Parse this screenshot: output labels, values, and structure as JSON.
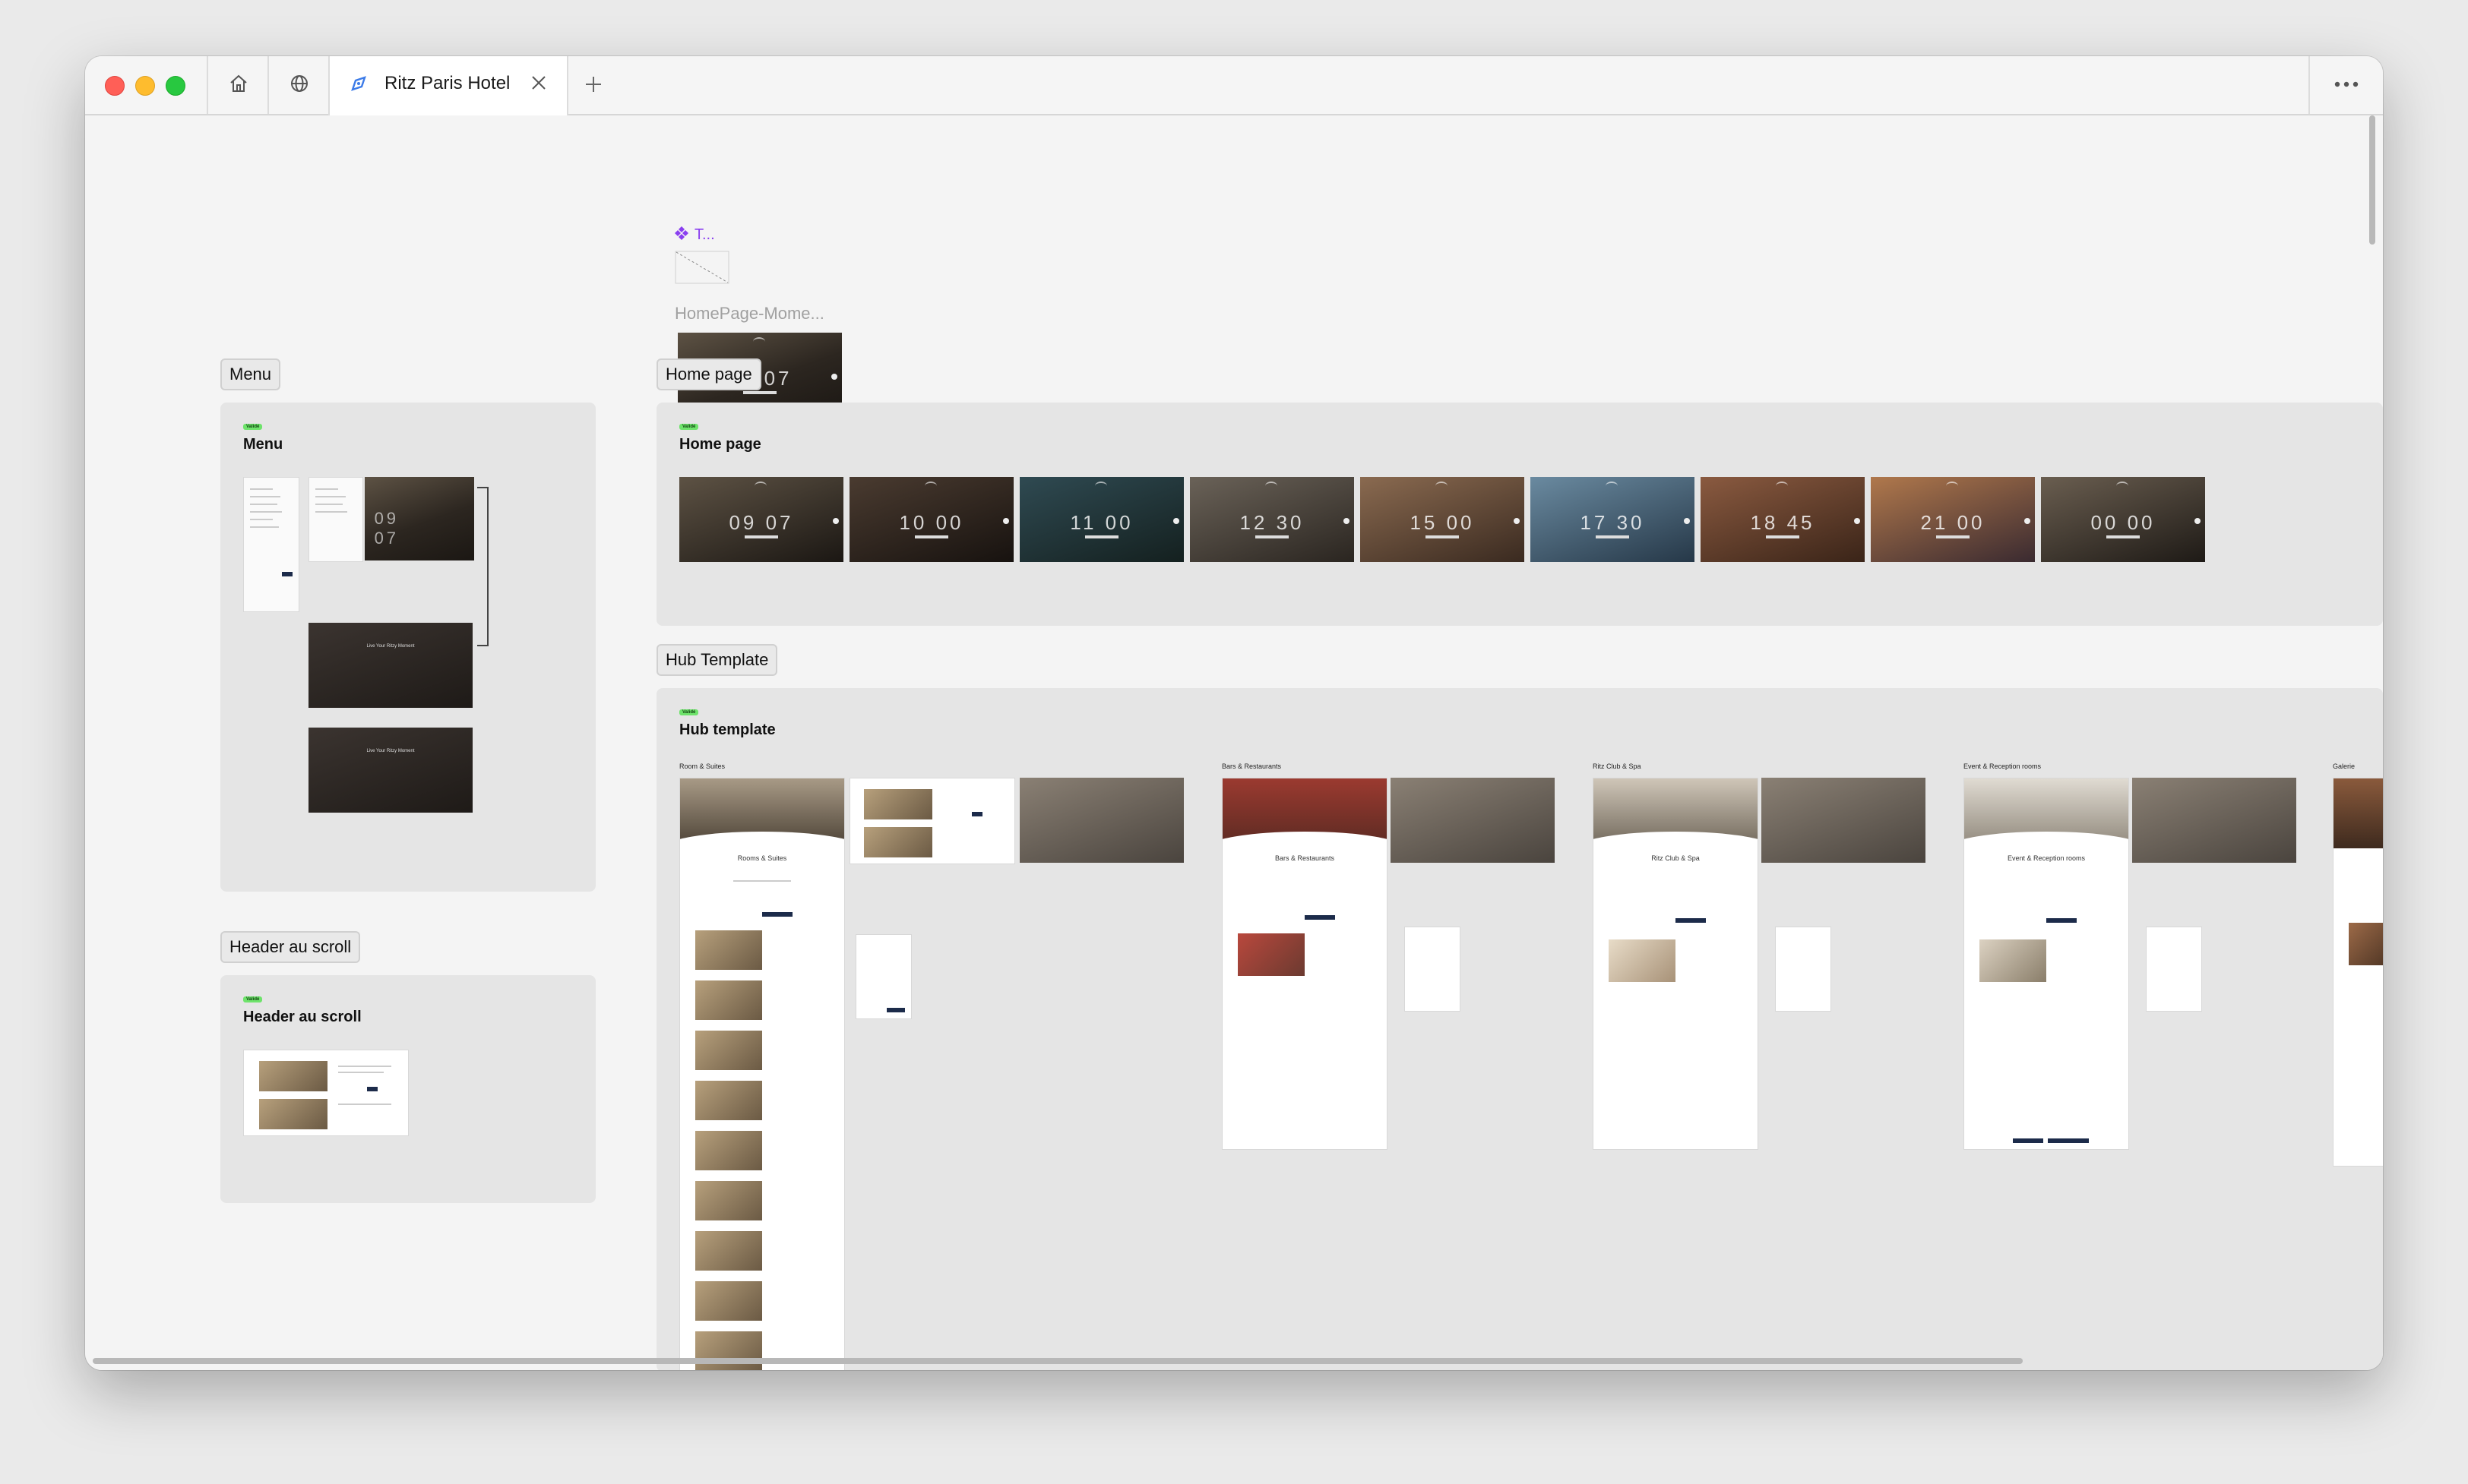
{
  "window": {
    "tab_title": "Ritz Paris Hotel",
    "icons": [
      "home-icon",
      "globe-icon",
      "figma-icon",
      "close-icon",
      "plus-icon",
      "more-icon"
    ]
  },
  "canvas": {
    "top_component": {
      "name": "T...",
      "frame_label": "HomePage-Mome...",
      "time": "09 07"
    },
    "chips": {
      "menu": "Menu",
      "home_page": "Home page",
      "hub_template": "Hub Template",
      "header_scroll": "Header au scroll"
    },
    "sections": {
      "menu": {
        "badge": "Validé",
        "title": "Menu",
        "hero_time": "09 07",
        "overlay_text": "Live Your Ritzy Moment"
      },
      "home_page": {
        "badge": "Validé",
        "title": "Home page",
        "times": [
          "09 07",
          "10 00",
          "11 00",
          "12 30",
          "15 00",
          "17 30",
          "18 45",
          "21 00",
          "00 00"
        ]
      },
      "hub_template": {
        "badge": "Validé",
        "title": "Hub template",
        "columns": [
          {
            "label": "Room & Suites",
            "page_title": "Rooms & Suites"
          },
          {
            "label": "Bars & Restaurants",
            "page_title": "Bars & Restaurants"
          },
          {
            "label": "Ritz Club & Spa",
            "page_title": "Ritz Club & Spa"
          },
          {
            "label": "Event & Reception rooms",
            "page_title": "Event & Reception rooms"
          },
          {
            "label": "Galerie",
            "page_title": ""
          }
        ]
      },
      "header_scroll": {
        "badge": "Validé",
        "title": "Header au scroll"
      }
    }
  },
  "colors": {
    "accent_navy": "#1c2b4a",
    "badge_green": "#6ee36b",
    "component_purple": "#8a3ff0"
  }
}
